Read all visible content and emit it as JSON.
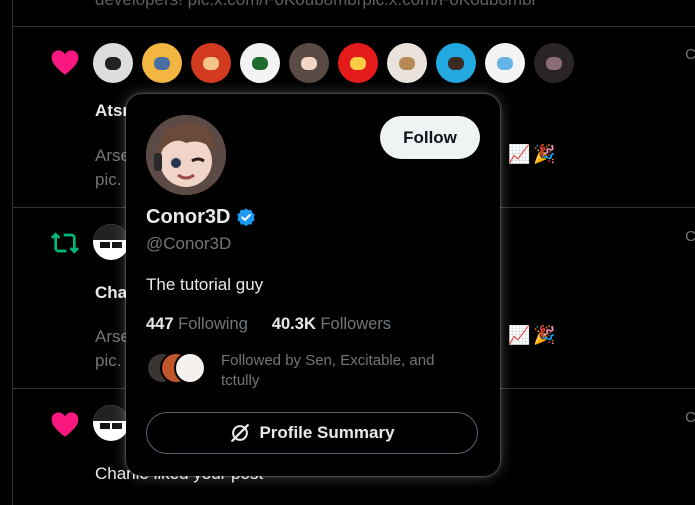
{
  "feed": {
    "top_cut_text": "developers! pic.x.com/FoKoub8mbrpic.x.com/FoKoub8mbr",
    "row1_name": "Atsı",
    "row1_sub1": "Arse",
    "row1_sub2": "pic.",
    "row2_name": "Cha",
    "row2_sub1": "Arse",
    "row2_sub2": "pic.",
    "row3_text": "Charlie liked your post",
    "emoji_chart": "📈",
    "emoji_party": "🎉",
    "right_mark": "C"
  },
  "card": {
    "follow_label": "Follow",
    "name": "Conor3D",
    "handle": "@Conor3D",
    "bio": "The tutorial guy",
    "following_count": "447",
    "following_label": "Following",
    "followers_count": "40.3K",
    "followers_label": "Followers",
    "followed_by": "Followed by Sen, Excitable, and tctully",
    "summary_label": "Profile Summary"
  },
  "colors": {
    "heart": "#f91880",
    "retweet": "#00ba7c",
    "verified": "#1d9bf0"
  },
  "icons": {
    "like": "heart-icon",
    "repost": "repost-icon",
    "verified": "verified-badge-icon",
    "summary": "grok-icon"
  }
}
